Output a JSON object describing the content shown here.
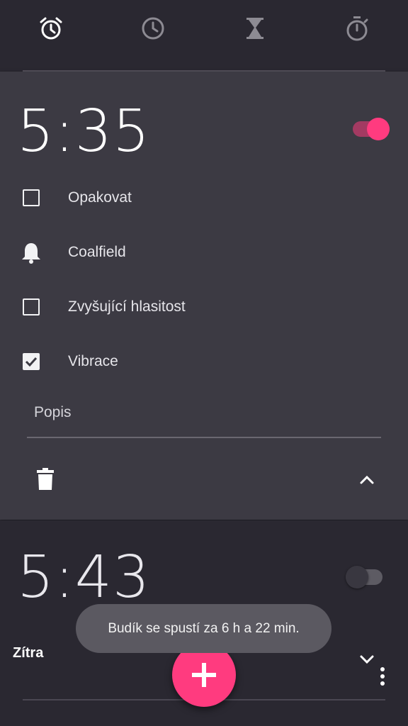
{
  "tabs": [
    {
      "icon": "alarm-icon",
      "selected": true
    },
    {
      "icon": "clock-icon",
      "selected": false
    },
    {
      "icon": "timer-hourglass-icon",
      "selected": false
    },
    {
      "icon": "stopwatch-icon",
      "selected": false
    }
  ],
  "alarm1": {
    "time": "5:35",
    "enabled": true,
    "options": [
      {
        "label": "Opakovat",
        "icon": "checkbox-empty-icon",
        "checked": false
      },
      {
        "label": "Coalfield",
        "icon": "bell-icon"
      },
      {
        "label": "Zvyšující hlasitost",
        "icon": "checkbox-empty-icon",
        "checked": false
      },
      {
        "label": "Vibrace",
        "icon": "checkbox-checked-icon",
        "checked": true
      }
    ],
    "description_placeholder": "Popis"
  },
  "alarm2": {
    "time": "5:43",
    "enabled": false,
    "day": "Zítra"
  },
  "toast": "Budík se spustí za 6 h a 22 min.",
  "colors": {
    "accent": "#ff3b7f",
    "card_expanded": "#3c3a43",
    "background": "#2a2831",
    "toast": "#5b5961"
  }
}
